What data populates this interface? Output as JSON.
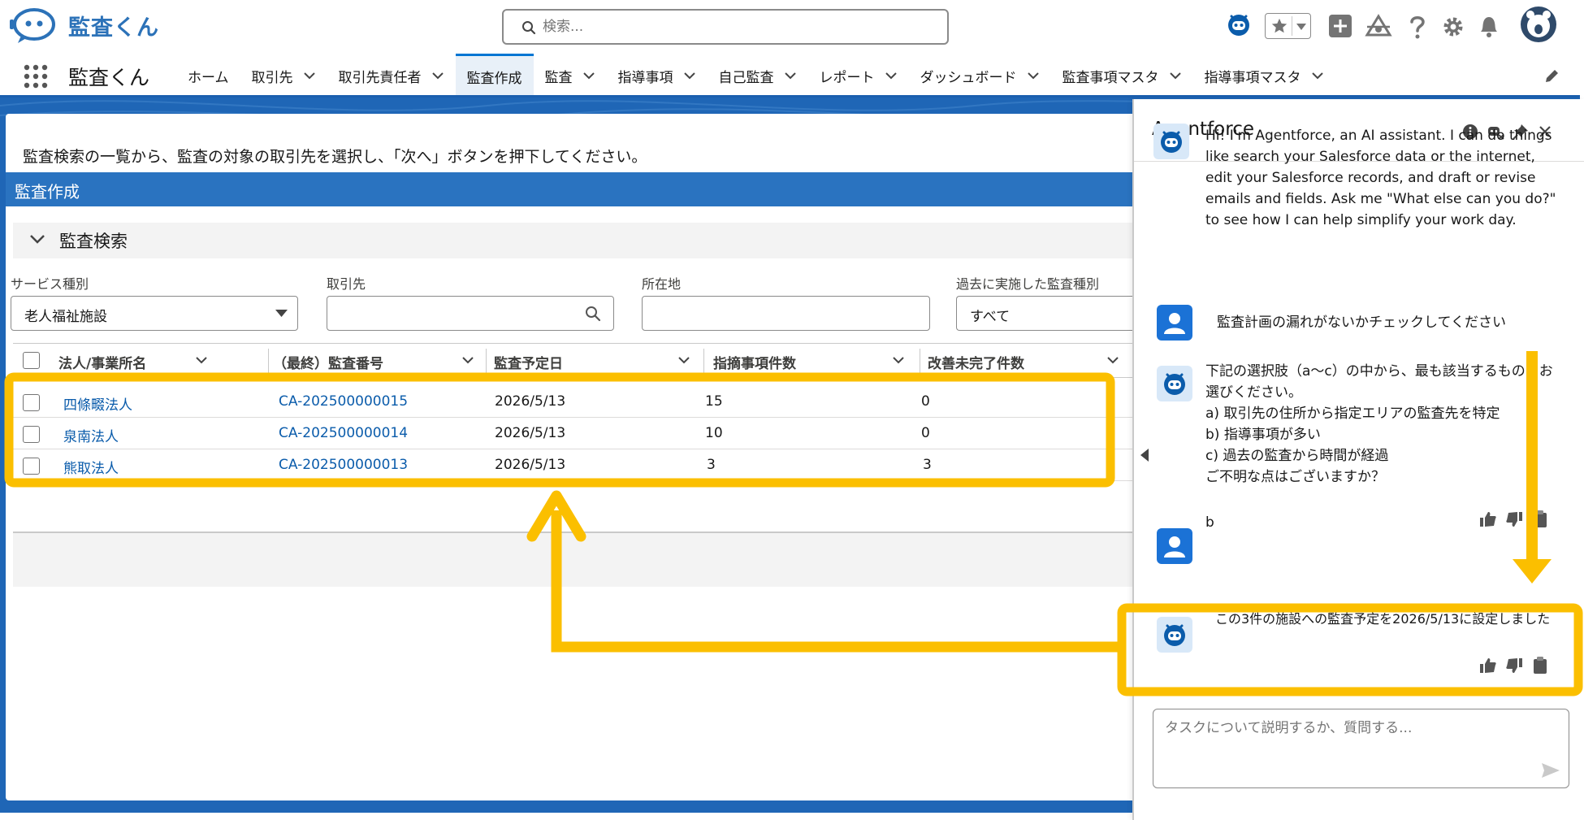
{
  "header": {
    "brand": "監査くん",
    "search_placeholder": "検索..."
  },
  "nav": {
    "app_name": "監査くん",
    "tabs": [
      {
        "label": "ホーム",
        "has_menu": false,
        "active": false
      },
      {
        "label": "取引先",
        "has_menu": true,
        "active": false
      },
      {
        "label": "取引先責任者",
        "has_menu": true,
        "active": false
      },
      {
        "label": "監査作成",
        "has_menu": false,
        "active": true
      },
      {
        "label": "監査",
        "has_menu": true,
        "active": false
      },
      {
        "label": "指導事項",
        "has_menu": true,
        "active": false
      },
      {
        "label": "自己監査",
        "has_menu": true,
        "active": false
      },
      {
        "label": "レポート",
        "has_menu": true,
        "active": false
      },
      {
        "label": "ダッシュボード",
        "has_menu": true,
        "active": false
      },
      {
        "label": "監査事項マスタ",
        "has_menu": true,
        "active": false
      },
      {
        "label": "指導事項マスタ",
        "has_menu": true,
        "active": false
      }
    ]
  },
  "main": {
    "instruction": "監査検索の一覧から、監査の対象の取引先を選択し、「次へ」ボタンを押下してください。",
    "section_title": "監査作成",
    "search_section_title": "監査検索",
    "filters": {
      "service_type_label": "サービス種別",
      "service_type_value": "老人福祉施設",
      "account_label": "取引先",
      "address_label": "所在地",
      "past_audit_label": "過去に実施した監査種別",
      "past_audit_value": "すべて"
    },
    "table": {
      "columns": [
        "法人/事業所名",
        "（最終）監査番号",
        "監査予定日",
        "指摘事項件数",
        "改善未完了件数"
      ],
      "rows": [
        {
          "name": "四條畷法人",
          "audit_no": "CA-202500000015",
          "date": "2026/5/13",
          "findings": "15",
          "open": "0"
        },
        {
          "name": "泉南法人",
          "audit_no": "CA-202500000014",
          "date": "2026/5/13",
          "findings": "10",
          "open": "0"
        },
        {
          "name": "熊取法人",
          "audit_no": "CA-202500000013",
          "date": "2026/5/13",
          "findings": "3",
          "open": "3"
        }
      ]
    }
  },
  "agent": {
    "title": "Agentforce",
    "intro": "Hi! I'm Agentforce, an AI assistant. I can do things like search your Salesforce data or the internet, edit your Salesforce records, and draft or revise emails and fields. Ask me \"What else can you do?\" to see how I can help simplify your work day.",
    "user_msg_1": "監査計画の漏れがないかチェックしてください",
    "bot_msg_2": "下記の選択肢（a〜c）の中から、最も該当するものをお選びください。\na) 取引先の住所から指定エリアの監査先を特定\nb) 指導事項が多い\nc) 過去の監査から時間が経過\nご不明な点はございますか？",
    "user_msg_2": "b",
    "bot_msg_3": "この3件の施設への監査予定を2026/5/13に設定しました",
    "input_placeholder": "タスクについて説明するか、質問する..."
  },
  "annotation_color": "#fbbf00",
  "colors": {
    "brand": "#2c72b8",
    "section_blue": "#2a73c0",
    "link": "#0b5cab"
  }
}
